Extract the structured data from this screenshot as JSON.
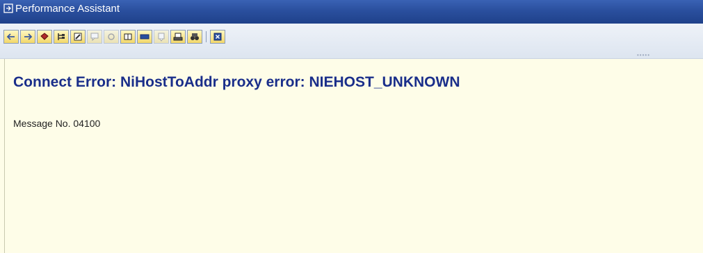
{
  "window": {
    "title": "Performance Assistant"
  },
  "toolbar": {
    "buttons": [
      {
        "icon": "back-arrow-icon"
      },
      {
        "icon": "forward-arrow-icon"
      },
      {
        "icon": "book-icon"
      },
      {
        "icon": "tree-structure-icon"
      },
      {
        "icon": "edit-pencil-icon"
      },
      {
        "icon": "speech-bubble-icon"
      },
      {
        "icon": "hand-pointer-icon"
      },
      {
        "icon": "open-book-icon"
      },
      {
        "icon": "keyboard-icon"
      },
      {
        "icon": "note-icon"
      },
      {
        "icon": "print-icon"
      },
      {
        "icon": "find-binoculars-icon"
      },
      {
        "icon": "close-window-icon"
      }
    ]
  },
  "content": {
    "error_title": "Connect Error: NiHostToAddr proxy error: NIEHOST_UNKNOWN",
    "message_no": "Message No. 04100"
  }
}
